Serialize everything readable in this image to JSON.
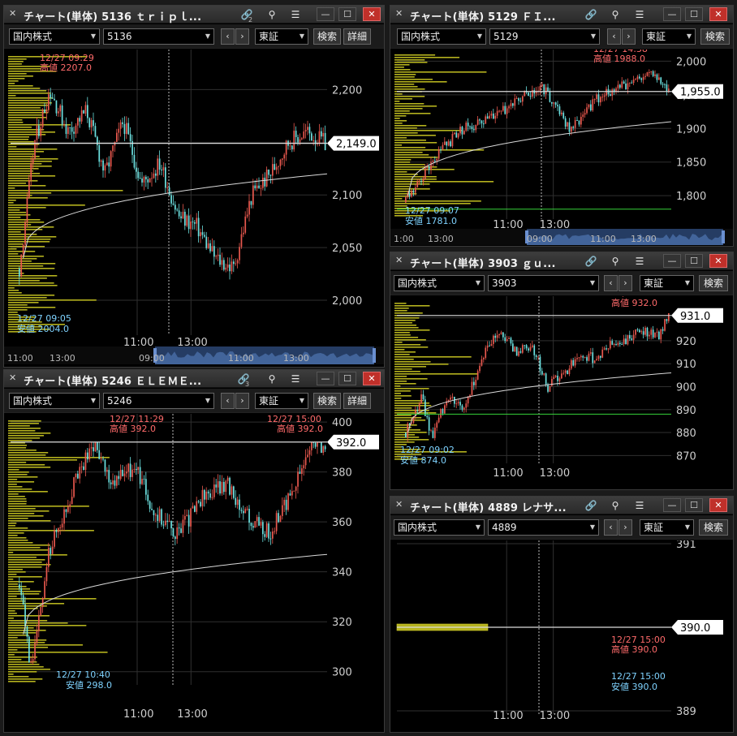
{
  "common": {
    "market_select": "国内株式",
    "exchange_select": "東証",
    "search_button": "検索",
    "detail_button": "詳細",
    "prev_glyph": "‹",
    "next_glyph": "›",
    "colors": {
      "up": "#e8584e",
      "down": "#6ce0df",
      "volume_profile": "#b5b21e",
      "vwap": "#d9d9d9",
      "high_label": "#ff6b6b",
      "low_label": "#7fd3ff",
      "green_line": "#36d23a",
      "range_fill": "#4a6ea8"
    },
    "icons": [
      "pin-icon",
      "link-icon",
      "search-icon",
      "menu-icon",
      "minimize-icon",
      "maximize-icon",
      "close-icon"
    ]
  },
  "windows": [
    {
      "id": "w5136",
      "title": "チャート(単体) 5136 ｔｒｉｐｌ...",
      "link_color": "blue",
      "link_number": "2",
      "code": "5136",
      "has_detail": true,
      "price_axis": [
        "2,200",
        "2,150",
        "2,100",
        "2,050",
        "2,000"
      ],
      "current_price": "2,149.0",
      "time_labels": [
        "11:00",
        "13:00"
      ],
      "nav_time_labels": [
        "11:00",
        "13:00",
        "09:00",
        "11:00",
        "13:00"
      ],
      "high": {
        "date": "12/27 09:29",
        "text": "高値 2207.0"
      },
      "low": {
        "date": "12/27 09:05",
        "text": "安値 2004.0"
      },
      "chart_data": {
        "type": "candlestick",
        "ylim": [
          1970,
          2235
        ],
        "open": 2030,
        "close": 2149,
        "high": 2207,
        "low": 2004,
        "pattern": [
          [
            0.0,
            2030
          ],
          [
            0.05,
            2150
          ],
          [
            0.1,
            2200
          ],
          [
            0.16,
            2160
          ],
          [
            0.22,
            2180
          ],
          [
            0.28,
            2120
          ],
          [
            0.34,
            2170
          ],
          [
            0.4,
            2110
          ],
          [
            0.46,
            2130
          ],
          [
            0.52,
            2080
          ],
          [
            0.58,
            2070
          ],
          [
            0.64,
            2040
          ],
          [
            0.7,
            2030
          ],
          [
            0.76,
            2100
          ],
          [
            0.82,
            2120
          ],
          [
            0.88,
            2150
          ],
          [
            0.94,
            2160
          ],
          [
            1.0,
            2149
          ]
        ],
        "vwap_start": 2040,
        "vwap_end": 2120
      }
    },
    {
      "id": "w5129",
      "title": "チャート(単体) 5129 ＦＩ...",
      "link_color": "white",
      "link_number": "",
      "code": "5129",
      "has_detail": false,
      "price_axis": [
        "2,000",
        "1,950",
        "1,900",
        "1,850",
        "1,800"
      ],
      "current_price": "1,955.0",
      "time_labels": [
        "11:00",
        "13:00"
      ],
      "nav_time_labels": [
        "1:00",
        "13:00",
        "09:00",
        "11:00",
        "13:00"
      ],
      "high": {
        "date": "12/27 14:38",
        "text": "高値 1988.0"
      },
      "low": {
        "date": "12/27 09:07",
        "text": "安値 1781.0"
      },
      "chart_data": {
        "type": "candlestick",
        "ylim": [
          1770,
          2015
        ],
        "open": 1790,
        "close": 1955,
        "high": 1988,
        "low": 1781,
        "pattern": [
          [
            0.0,
            1790
          ],
          [
            0.06,
            1830
          ],
          [
            0.14,
            1870
          ],
          [
            0.22,
            1900
          ],
          [
            0.3,
            1910
          ],
          [
            0.38,
            1930
          ],
          [
            0.45,
            1950
          ],
          [
            0.52,
            1960
          ],
          [
            0.58,
            1930
          ],
          [
            0.62,
            1900
          ],
          [
            0.68,
            1920
          ],
          [
            0.74,
            1950
          ],
          [
            0.8,
            1960
          ],
          [
            0.88,
            1970
          ],
          [
            0.94,
            1985
          ],
          [
            1.0,
            1955
          ]
        ],
        "vwap_start": 1800,
        "vwap_end": 1910
      }
    },
    {
      "id": "w3903",
      "title": "チャート(単体) 3903 ｇｕ...",
      "link_color": "white",
      "link_number": "",
      "code": "3903",
      "has_detail": false,
      "price_axis": [
        "930",
        "920",
        "910",
        "900",
        "890",
        "880",
        "870"
      ],
      "current_price": "931.0",
      "time_labels": [
        "11:00",
        "13:00"
      ],
      "high": {
        "date": "12/27 14:59",
        "text": "高値 932.0"
      },
      "low": {
        "date": "12/27 09:02",
        "text": "安値 874.0"
      },
      "chart_data": {
        "type": "candlestick",
        "ylim": [
          868,
          938
        ],
        "open": 880,
        "close": 931,
        "high": 932,
        "low": 874,
        "pattern": [
          [
            0.0,
            880
          ],
          [
            0.06,
            895
          ],
          [
            0.1,
            878
          ],
          [
            0.16,
            896
          ],
          [
            0.22,
            890
          ],
          [
            0.3,
            915
          ],
          [
            0.36,
            925
          ],
          [
            0.42,
            915
          ],
          [
            0.48,
            918
          ],
          [
            0.54,
            900
          ],
          [
            0.6,
            905
          ],
          [
            0.66,
            915
          ],
          [
            0.72,
            912
          ],
          [
            0.78,
            918
          ],
          [
            0.84,
            920
          ],
          [
            0.9,
            925
          ],
          [
            0.96,
            922
          ],
          [
            1.0,
            931
          ]
        ],
        "vwap_start": 880,
        "vwap_end": 906
      }
    },
    {
      "id": "w5246",
      "title": "チャート(単体) 5246 ＥＬＥＭＥ...",
      "link_color": "green",
      "link_number": "3",
      "code": "5246",
      "has_detail": true,
      "price_axis": [
        "400",
        "380",
        "360",
        "340",
        "320",
        "300"
      ],
      "current_price": "392.0",
      "time_labels": [
        "11:00",
        "13:00"
      ],
      "high": {
        "date": "12/27 11:29",
        "text": "高値 392.0"
      },
      "high2": {
        "date": "12/27 15:00",
        "text": "高値 392.0"
      },
      "low": {
        "date": "12/27 10:40",
        "text": "安値 298.0"
      },
      "chart_data": {
        "type": "candlestick",
        "ylim": [
          296,
          402
        ],
        "open": 335,
        "close": 390,
        "high": 392,
        "low": 298,
        "pattern": [
          [
            0.0,
            335
          ],
          [
            0.04,
            300
          ],
          [
            0.1,
            350
          ],
          [
            0.18,
            375
          ],
          [
            0.24,
            392
          ],
          [
            0.3,
            375
          ],
          [
            0.38,
            382
          ],
          [
            0.44,
            365
          ],
          [
            0.52,
            355
          ],
          [
            0.6,
            370
          ],
          [
            0.68,
            375
          ],
          [
            0.76,
            360
          ],
          [
            0.82,
            355
          ],
          [
            0.9,
            375
          ],
          [
            0.96,
            392
          ],
          [
            1.0,
            390
          ]
        ],
        "vwap_start": 315,
        "vwap_end": 347
      }
    },
    {
      "id": "w4889",
      "title": "チャート(単体) 4889 レナサ...",
      "link_color": "white",
      "link_number": "",
      "code": "4889",
      "has_detail": false,
      "price_axis": [
        "391",
        "389"
      ],
      "current_price": "390.0",
      "time_labels": [
        "11:00",
        "13:00"
      ],
      "high": {
        "date": "12/27 15:00",
        "text": "高値 390.0"
      },
      "low": {
        "date": "12/27 15:00",
        "text": "安値 390.0"
      },
      "chart_data": {
        "type": "candlestick",
        "ylim": [
          389,
          391
        ],
        "open": 390,
        "close": 390,
        "high": 390,
        "low": 390,
        "pattern": [],
        "vwap_start": 390,
        "vwap_end": 390
      }
    }
  ]
}
